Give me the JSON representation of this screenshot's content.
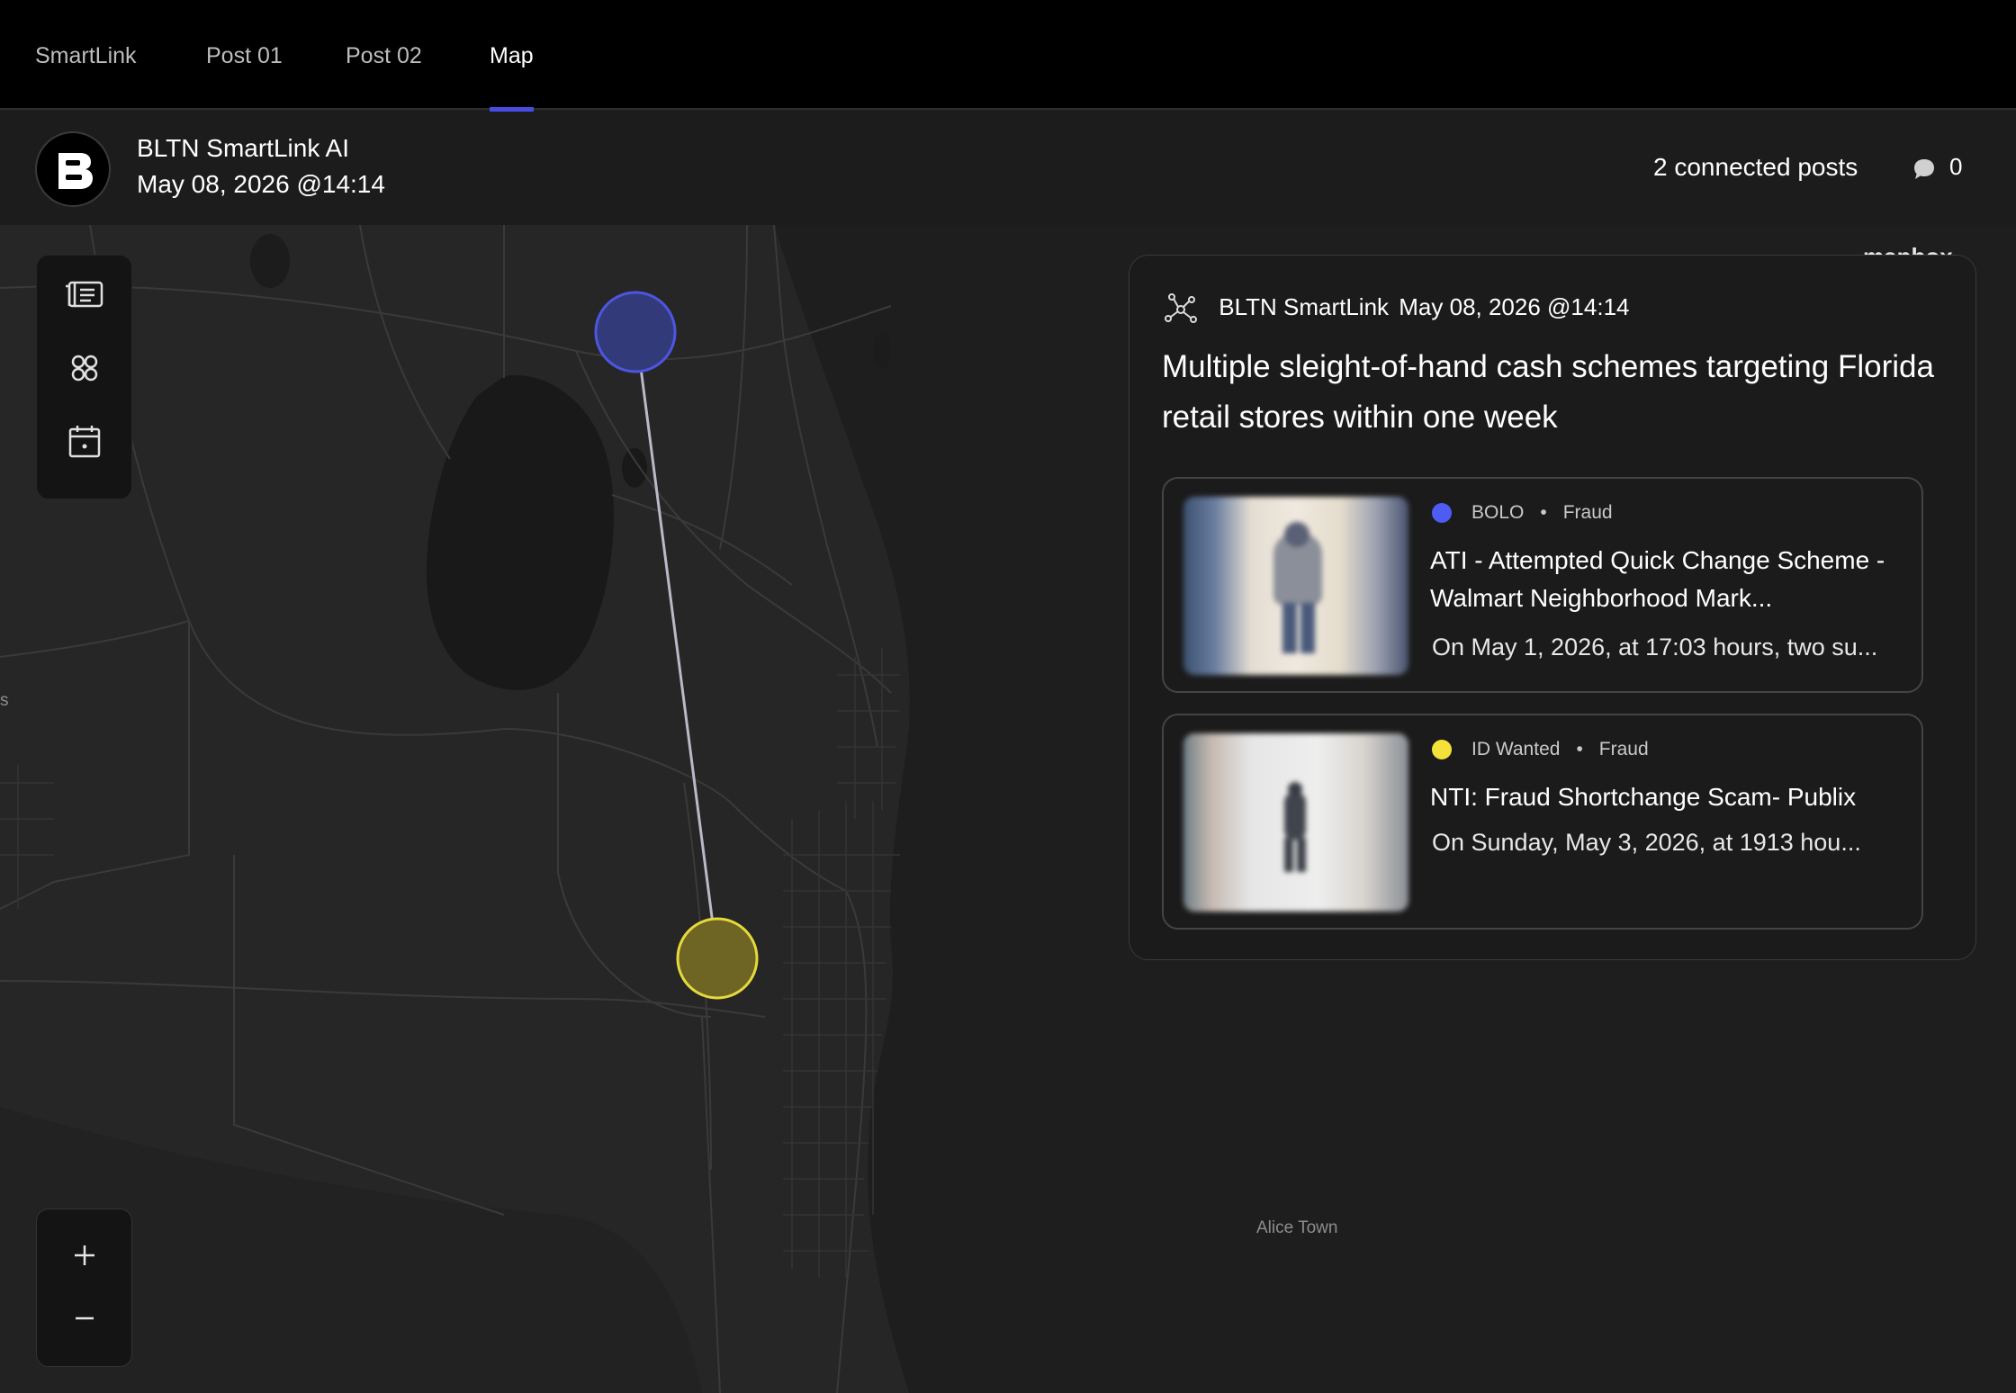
{
  "tabs": [
    {
      "label": "SmartLink",
      "active": false
    },
    {
      "label": "Post 01",
      "active": false
    },
    {
      "label": "Post 02",
      "active": false
    },
    {
      "label": "Map",
      "active": true
    }
  ],
  "header": {
    "source_name": "BLTN SmartLink AI",
    "date": "May 08, 2026 @14:14",
    "connected_posts": "2 connected posts",
    "comment_count": "0"
  },
  "map": {
    "attribution": "mapbox",
    "place_labels": [
      "Alice Town",
      "s"
    ],
    "markers": [
      {
        "name": "BOLO",
        "color": "#4a4fd6"
      },
      {
        "name": "ID Wanted",
        "color": "#e3d23a"
      }
    ]
  },
  "card": {
    "source": "BLTN SmartLink",
    "timestamp": "May 08, 2026 @14:14",
    "title": "Multiple sleight-of-hand cash schemes targeting Florida retail stores within one week",
    "posts": [
      {
        "category": "BOLO",
        "type": "Fraud",
        "color": "#4f5bf5",
        "title": "ATI - Attempted Quick Change Scheme - Walmart Neighborhood Mark...",
        "snippet": "On May 1, 2026, at 17:03 hours, two su..."
      },
      {
        "category": "ID Wanted",
        "type": "Fraud",
        "color": "#f4e23a",
        "title": "NTI: Fraud Shortchange Scam- Publix",
        "snippet": "On Sunday, May 3, 2026, at 1913 hou..."
      }
    ]
  },
  "icons": {
    "logo": "bltn-logo-icon",
    "comment": "comment-bubble-icon",
    "list": "list-icon",
    "grid": "grid-icon",
    "calendar": "calendar-icon",
    "zoom_in": "plus-icon",
    "zoom_out": "minus-icon",
    "network": "network-icon"
  }
}
